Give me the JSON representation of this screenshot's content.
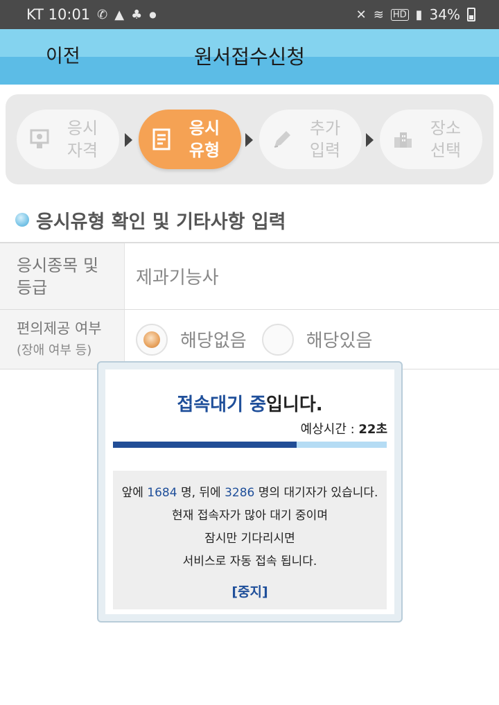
{
  "status_bar": {
    "carrier_time": "KT 10:01",
    "battery": "34%",
    "icons": [
      "volte-icon",
      "notification-icon",
      "silent-icon",
      "wifi-icon",
      "hd-icon",
      "signal-icon",
      "battery-icon"
    ]
  },
  "header": {
    "back_label": "이전",
    "title": "원서접수신청",
    "colors": {
      "top": "#84d3ef",
      "bottom": "#5cbce6"
    }
  },
  "steps": [
    {
      "line1": "응시",
      "line2": "자격",
      "icon": "certificate-icon",
      "active": false
    },
    {
      "line1": "응시",
      "line2": "유형",
      "icon": "document-icon",
      "active": true
    },
    {
      "line1": "추가",
      "line2": "입력",
      "icon": "pencil-icon",
      "active": false
    },
    {
      "line1": "장소",
      "line2": "선택",
      "icon": "building-icon",
      "active": false
    }
  ],
  "section": {
    "title": "응시유형 확인 및 기타사항 입력"
  },
  "form": {
    "exam_type_label_1": "응시종목 및",
    "exam_type_label_2": "등급",
    "exam_type_value": "제과기능사",
    "accommodation_label": "편의제공 여부",
    "accommodation_sublabel": "(장애 여부 등)",
    "options": [
      {
        "label": "해당없음",
        "checked": true
      },
      {
        "label": "해당있음",
        "checked": false
      }
    ]
  },
  "popup": {
    "title_blue": "접속대기 중",
    "title_dark": "입니다.",
    "eta_label": "예상시간 : ",
    "eta_value": "22초",
    "progress_fraction": 0.67,
    "ahead_prefix": "앞에 ",
    "ahead_count": "1684",
    "ahead_mid": " 명, 뒤에 ",
    "behind_count": "3286",
    "behind_suffix": " 명의 대기자가 있습니다.",
    "line2": "현재 접속자가 많아 대기 중이며",
    "line3": "잠시만 기다리시면",
    "line4": "서비스로 자동 접속 됩니다.",
    "stop_label": "[중지]",
    "colors": {
      "accent": "#1f4f9a",
      "progress_track": "#b5dcf4",
      "progress_fill": "#214d96"
    }
  }
}
